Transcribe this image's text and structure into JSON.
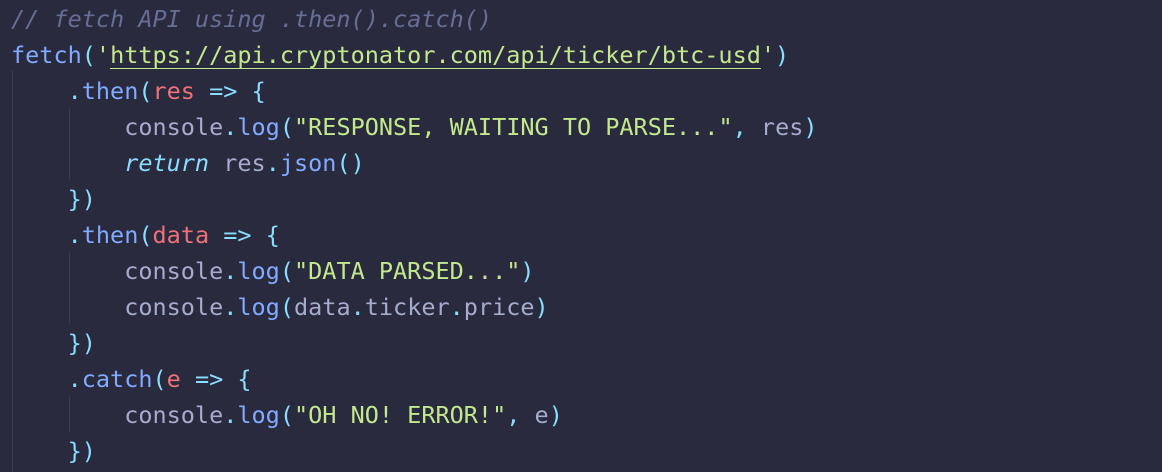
{
  "theme": {
    "background": "#292a3e",
    "comment": "#676e95",
    "function": "#82aaff",
    "punctuation": "#89ddff",
    "parameter": "#f07178",
    "string": "#c3e88d",
    "plain": "#a6accd",
    "indent_guide": "#3b3d55"
  },
  "code": {
    "comment": "// fetch API using .then().catch()",
    "fetch_fn": "fetch",
    "url": "https://api.cryptonator.com/api/ticker/btc-usd",
    "then_method": "then",
    "catch_method": "catch",
    "arrow": "=>",
    "param_res": "res",
    "param_data": "data",
    "param_e": "e",
    "console_obj": "console",
    "log_fn": "log",
    "msg_response": "\"RESPONSE, WAITING TO PARSE...\"",
    "return_kw": "return",
    "json_fn": "json",
    "msg_parsed": "\"DATA PARSED...\"",
    "ticker_prop": "ticker",
    "price_prop": "price",
    "msg_error": "\"OH NO! ERROR!\""
  }
}
